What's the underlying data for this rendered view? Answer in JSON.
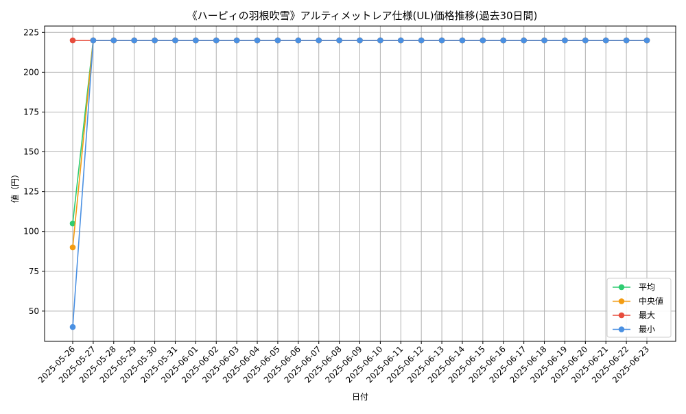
{
  "chart_data": {
    "type": "line",
    "title": "《ハーピィの羽根吹雪》アルティメットレア仕様(UL)価格推移(過去30日間)",
    "xlabel": "日付",
    "ylabel": "値（円）",
    "categories": [
      "2025-05-26",
      "2025-05-27",
      "2025-05-28",
      "2025-05-29",
      "2025-05-30",
      "2025-05-31",
      "2025-06-01",
      "2025-06-02",
      "2025-06-03",
      "2025-06-04",
      "2025-06-05",
      "2025-06-06",
      "2025-06-07",
      "2025-06-08",
      "2025-06-09",
      "2025-06-10",
      "2025-06-11",
      "2025-06-12",
      "2025-06-13",
      "2025-06-14",
      "2025-06-15",
      "2025-06-16",
      "2025-06-17",
      "2025-06-18",
      "2025-06-19",
      "2025-06-20",
      "2025-06-21",
      "2025-06-22",
      "2025-06-23"
    ],
    "ylim": [
      31,
      229
    ],
    "yticks": [
      50,
      75,
      100,
      125,
      150,
      175,
      200,
      225
    ],
    "grid": true,
    "legend_position": "bottom-right",
    "series": [
      {
        "name": "平均",
        "color": "#2ecc71",
        "values": [
          105,
          220,
          220,
          220,
          220,
          220,
          220,
          220,
          220,
          220,
          220,
          220,
          220,
          220,
          220,
          220,
          220,
          220,
          220,
          220,
          220,
          220,
          220,
          220,
          220,
          220,
          220,
          220,
          220
        ]
      },
      {
        "name": "中央値",
        "color": "#f39c12",
        "values": [
          90,
          220,
          220,
          220,
          220,
          220,
          220,
          220,
          220,
          220,
          220,
          220,
          220,
          220,
          220,
          220,
          220,
          220,
          220,
          220,
          220,
          220,
          220,
          220,
          220,
          220,
          220,
          220,
          220
        ]
      },
      {
        "name": "最大",
        "color": "#e74c3c",
        "values": [
          220,
          220,
          220,
          220,
          220,
          220,
          220,
          220,
          220,
          220,
          220,
          220,
          220,
          220,
          220,
          220,
          220,
          220,
          220,
          220,
          220,
          220,
          220,
          220,
          220,
          220,
          220,
          220,
          220
        ]
      },
      {
        "name": "最小",
        "color": "#4a90e2",
        "values": [
          40,
          220,
          220,
          220,
          220,
          220,
          220,
          220,
          220,
          220,
          220,
          220,
          220,
          220,
          220,
          220,
          220,
          220,
          220,
          220,
          220,
          220,
          220,
          220,
          220,
          220,
          220,
          220,
          220
        ]
      }
    ]
  }
}
